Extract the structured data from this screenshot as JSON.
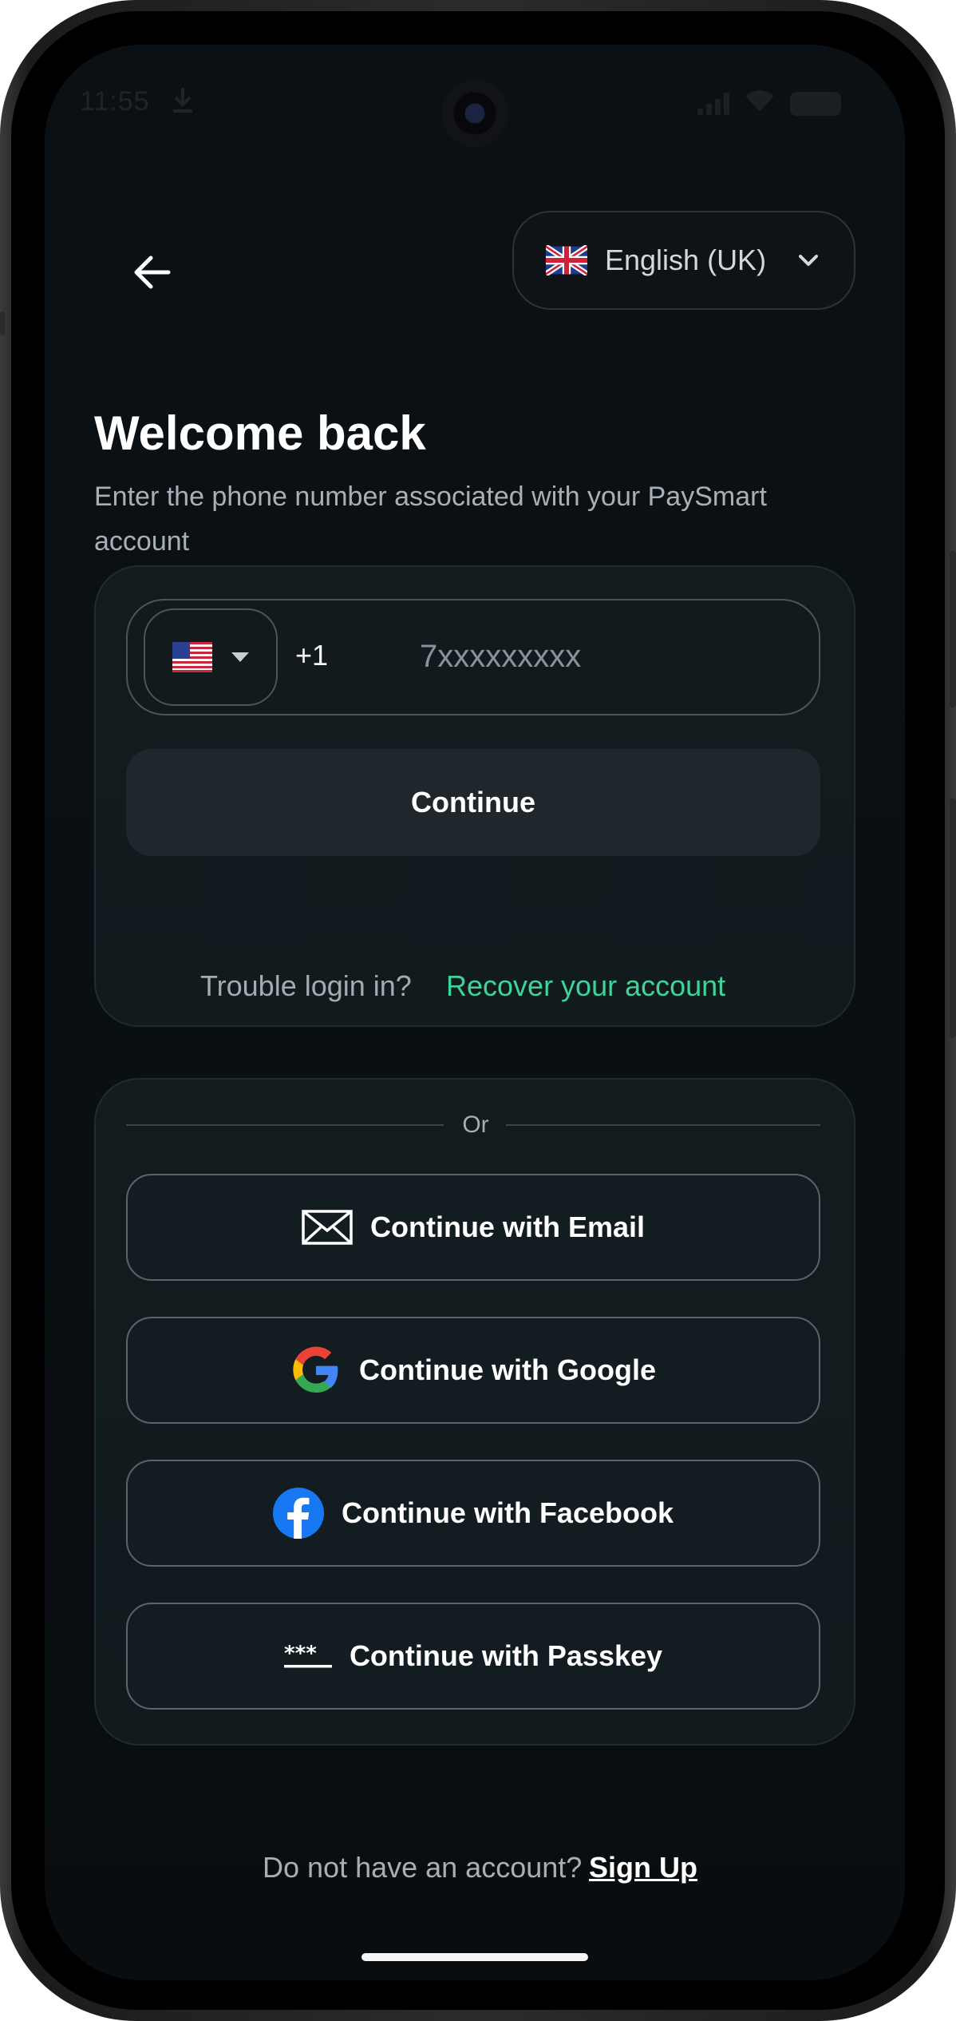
{
  "status_bar": {
    "time": "11:55"
  },
  "header": {
    "language_label": "English (UK)"
  },
  "welcome": {
    "title": "Welcome back",
    "subtitle": "Enter the phone number associated with your PaySmart account"
  },
  "login_form": {
    "dial_code": "+1",
    "phone_placeholder": "7xxxxxxxxx",
    "phone_value": "",
    "continue_label": "Continue",
    "trouble_text": "Trouble login in?",
    "recover_link": "Recover your account"
  },
  "alternatives": {
    "divider_text": "Or",
    "buttons": [
      {
        "label": "Continue with Email",
        "icon": "envelope-icon"
      },
      {
        "label": "Continue with Google",
        "icon": "google-icon"
      },
      {
        "label": "Continue with Facebook",
        "icon": "facebook-icon"
      },
      {
        "label": "Continue with Passkey",
        "icon": "passkey-icon"
      }
    ]
  },
  "footer": {
    "question": "Do not have an account?",
    "signup_link": "Sign Up"
  },
  "colors": {
    "accent_green": "#3fd39a",
    "background": "#0b1014",
    "card": "#121c1f",
    "facebook_blue": "#1877f2"
  }
}
